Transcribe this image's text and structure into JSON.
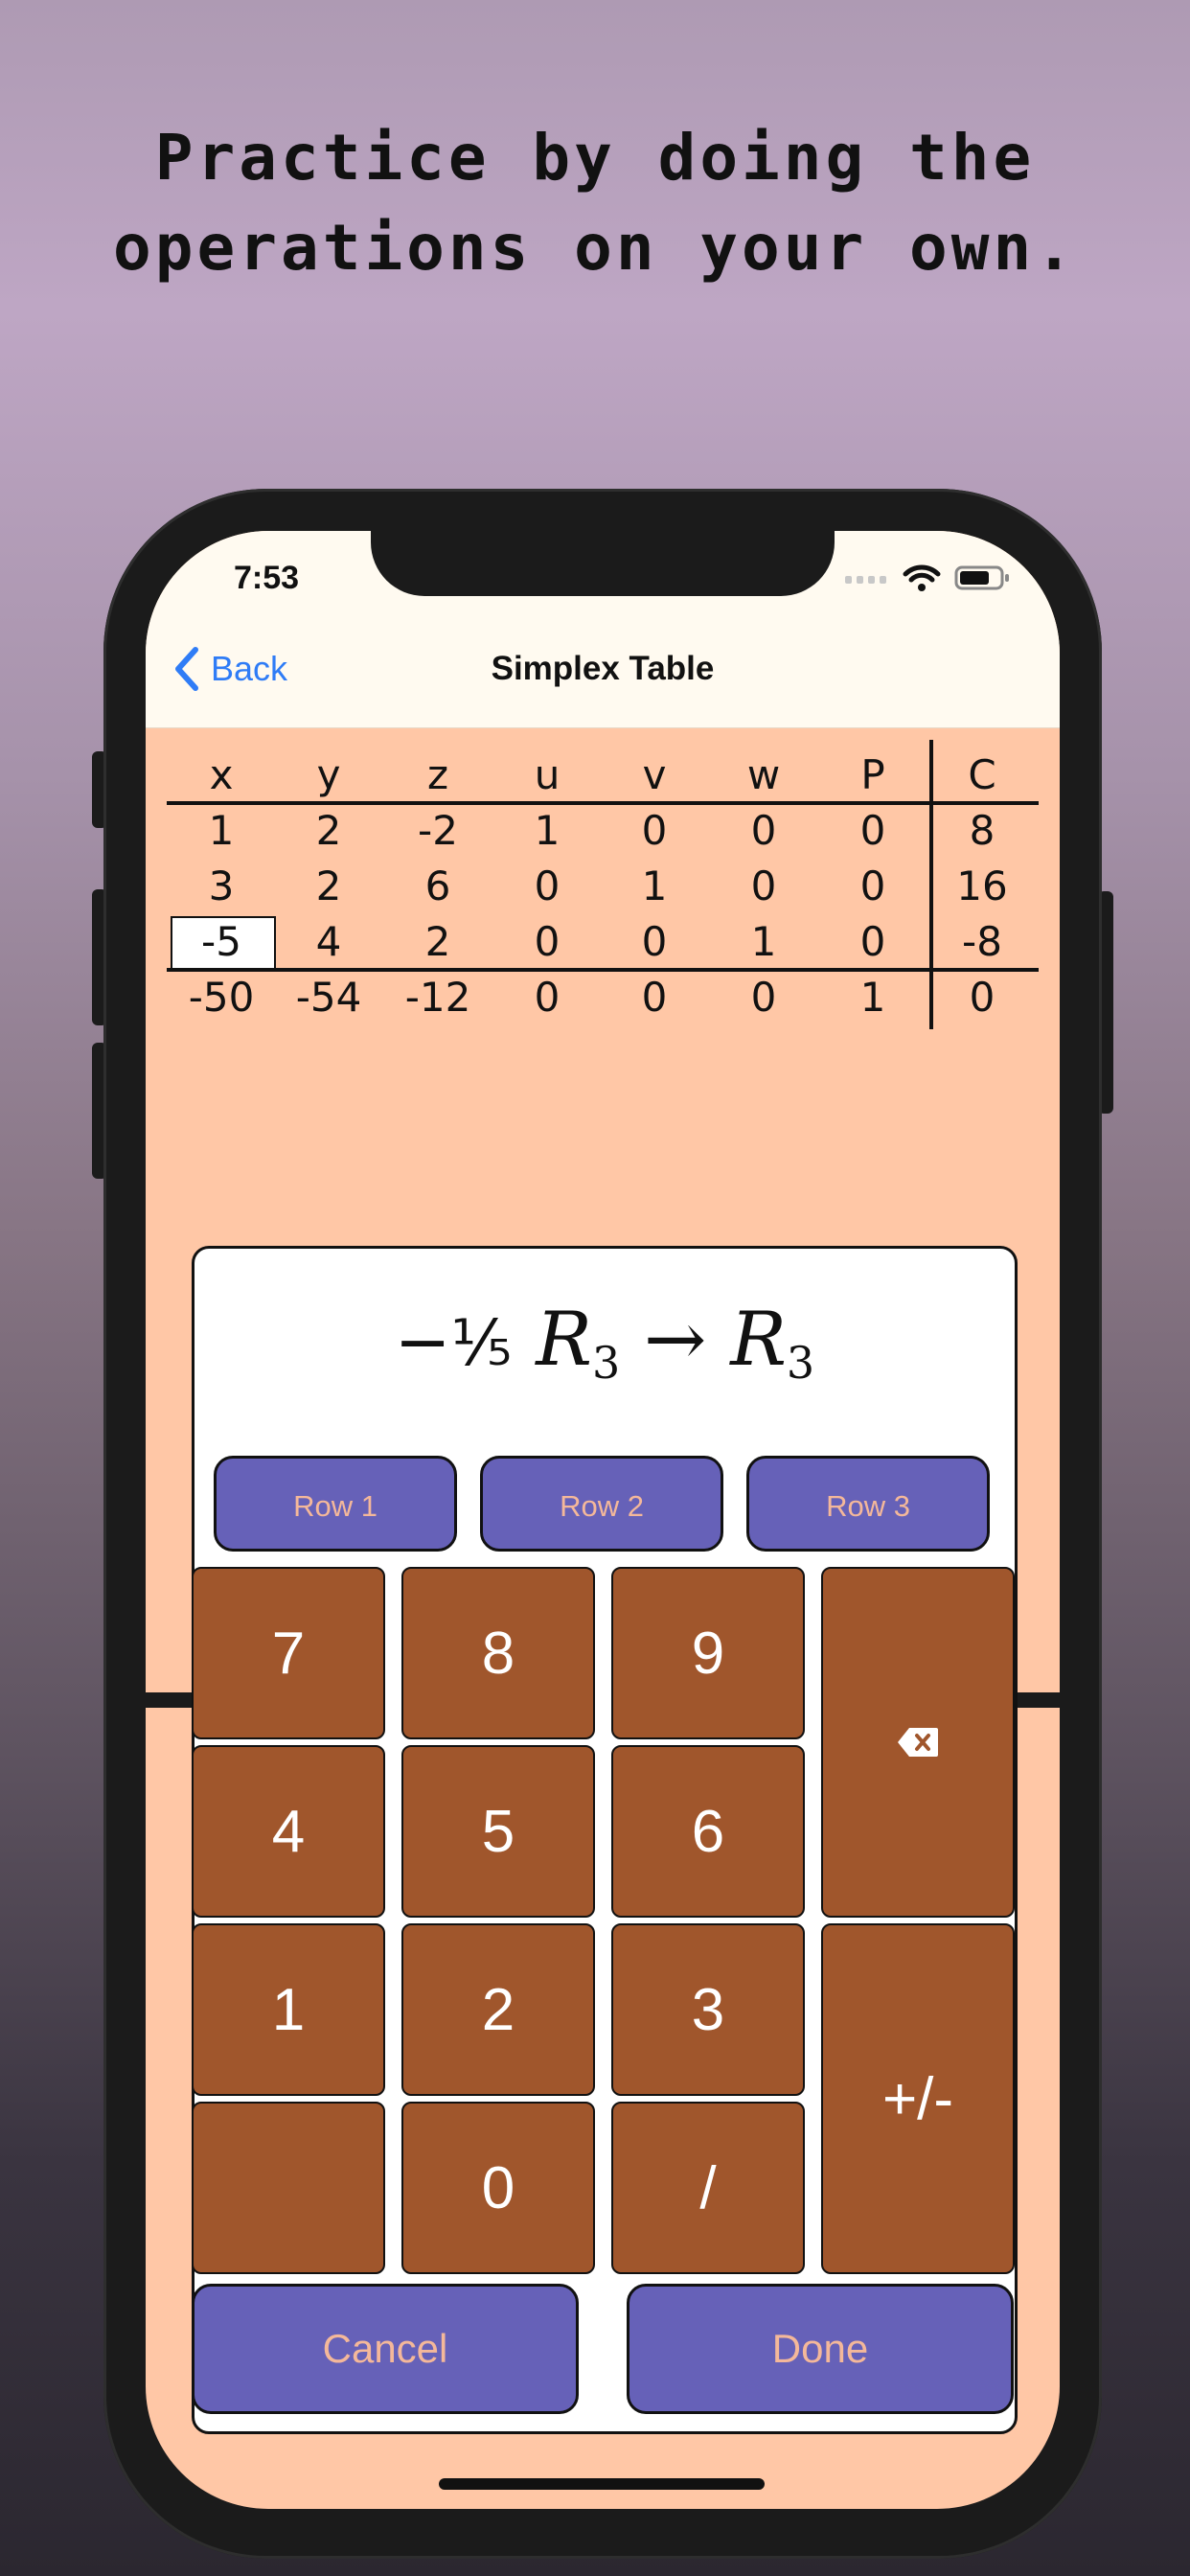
{
  "headline": {
    "line1": "Practice by doing the",
    "line2": "operations on your own."
  },
  "status_bar": {
    "time": "7:53"
  },
  "nav": {
    "back_label": "Back",
    "title": "Simplex Table"
  },
  "table": {
    "headers": [
      "x",
      "y",
      "z",
      "u",
      "v",
      "w",
      "P",
      "C"
    ],
    "rows": [
      [
        "1",
        "2",
        "-2",
        "1",
        "0",
        "0",
        "0",
        "8"
      ],
      [
        "3",
        "2",
        "6",
        "0",
        "1",
        "0",
        "0",
        "16"
      ],
      [
        "-5",
        "4",
        "2",
        "0",
        "0",
        "1",
        "0",
        "-8"
      ],
      [
        "-50",
        "-54",
        "-12",
        "0",
        "0",
        "0",
        "1",
        "0"
      ]
    ],
    "selected_cell": {
      "row": 2,
      "col": 0
    }
  },
  "formula": {
    "sign": "−",
    "fraction": "⅕",
    "row_symbol": "R",
    "source_sub": "3",
    "arrow": "→",
    "target_sub": "3"
  },
  "row_buttons": [
    "Row 1",
    "Row 2",
    "Row 3"
  ],
  "keys": {
    "k7": "7",
    "k8": "8",
    "k9": "9",
    "k4": "4",
    "k5": "5",
    "k6": "6",
    "k1": "1",
    "k2": "2",
    "k3": "3",
    "blank": "",
    "k0": "0",
    "slash": "/",
    "plusminus": "+/-"
  },
  "icons": {
    "backspace": "delete-backward-icon",
    "back": "chevron-left-icon"
  },
  "actions": {
    "cancel": "Cancel",
    "done": "Done"
  },
  "colors": {
    "background_top": "#ae9ab3",
    "screen_bg": "#ffc7a6",
    "nav_bg": "#fffaf0",
    "accent_blue": "#2f7cf6",
    "row_button": "#6661b8",
    "row_button_text": "#f4b89a",
    "key_brown": "#a0562c"
  }
}
